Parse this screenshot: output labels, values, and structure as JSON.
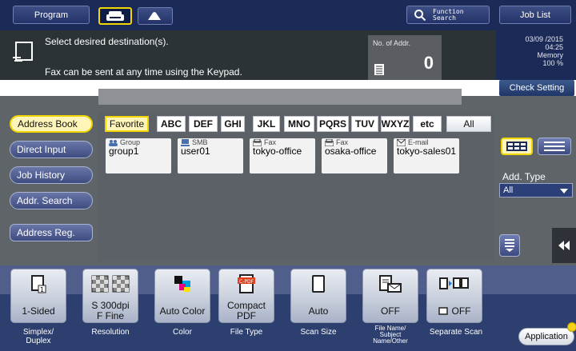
{
  "topbar": {
    "program_label": "Program",
    "function_search_label": "Function\nSearch",
    "job_list_label": "Job List"
  },
  "message": {
    "line1": "Select desired destination(s).",
    "line2": "Fax can be sent at any time using the Keypad.",
    "addr_label": "No. of Addr.",
    "addr_count": "0"
  },
  "status": {
    "date": "03/09 /2015",
    "time": "04:25",
    "memory_label": "Memory",
    "memory_value": "100 %",
    "check_setting": "Check Setting"
  },
  "sidebar": {
    "items": [
      {
        "label": "Address Book",
        "active": true
      },
      {
        "label": "Direct Input",
        "active": false
      },
      {
        "label": "Job History",
        "active": false
      },
      {
        "label": "Addr. Search",
        "active": false
      }
    ],
    "address_reg": "Address Reg."
  },
  "index_tabs": [
    "Favorite",
    "ABC",
    "DEF",
    "GHI",
    "JKL",
    "MNO",
    "PQRS",
    "TUV",
    "WXYZ",
    "etc",
    "All"
  ],
  "entries": [
    {
      "type": "Group",
      "name": "group1",
      "icon": "group-icon"
    },
    {
      "type": "SMB",
      "name": "user01",
      "icon": "computer-icon"
    },
    {
      "type": "Fax",
      "name": "tokyo-office",
      "icon": "fax-icon"
    },
    {
      "type": "Fax",
      "name": "osaka-office",
      "icon": "fax-icon"
    },
    {
      "type": "E-mail",
      "name": "tokyo-sales01",
      "icon": "mail-icon"
    }
  ],
  "add_type": {
    "label": "Add. Type",
    "value": "All"
  },
  "settings": [
    {
      "value": "1-Sided",
      "label": "Simplex/\nDuplex"
    },
    {
      "value": "S 300dpi\nF Fine",
      "label": "Resolution"
    },
    {
      "value": "Auto Color",
      "label": "Color"
    },
    {
      "value": "Compact\nPDF",
      "label": "File Type",
      "badge": "C-PDF"
    },
    {
      "value": "Auto",
      "label": "Scan Size"
    },
    {
      "value": "OFF",
      "label": "File Name/\nSubject\nName/Other"
    },
    {
      "value": "OFF",
      "label": "Separate Scan"
    }
  ],
  "application_label": "Application",
  "colors": {
    "navy": "#1b2a56",
    "highlight": "#f2d600",
    "panel": "#5f6469"
  }
}
